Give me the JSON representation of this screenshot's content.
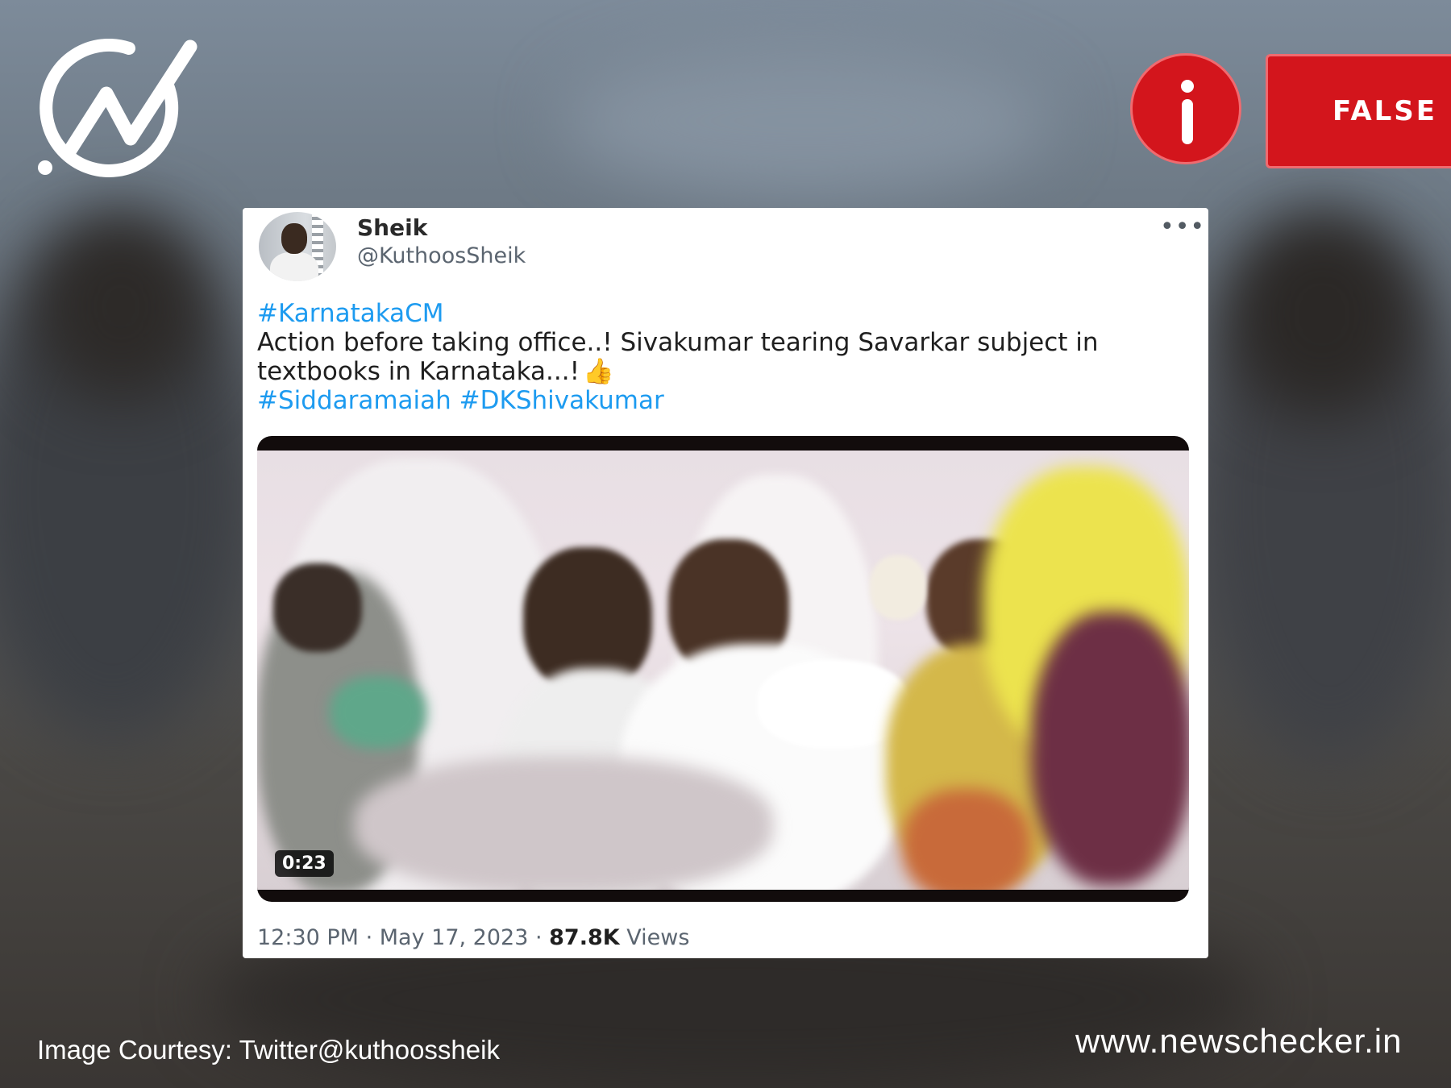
{
  "brand": {
    "logo_icon": "newschecker-logo-icon",
    "website": "www.newschecker.in",
    "image_courtesy": "Image Courtesy: Twitter@kuthoossheik"
  },
  "verdict": {
    "icon": "info-icon",
    "label": "FALSE",
    "color": "#d3151c"
  },
  "tweet": {
    "author_name": "Sheik",
    "author_handle": "@KuthoosSheik",
    "more_icon": "more-options-icon",
    "hashtag_top": "#KarnatakaCM",
    "body_text": "Action before taking office..! Sivakumar tearing Savarkar subject in textbooks in Karnataka...!",
    "emoji": "👍",
    "hashtag_one": "#Siddaramaiah",
    "hashtag_two": "#DKShivakumar",
    "video_duration": "0:23",
    "time": "12:30 PM",
    "date": "May 17, 2023",
    "views_count": "87.8K",
    "views_label": "Views",
    "hashtag_color": "#1d9bf0"
  }
}
